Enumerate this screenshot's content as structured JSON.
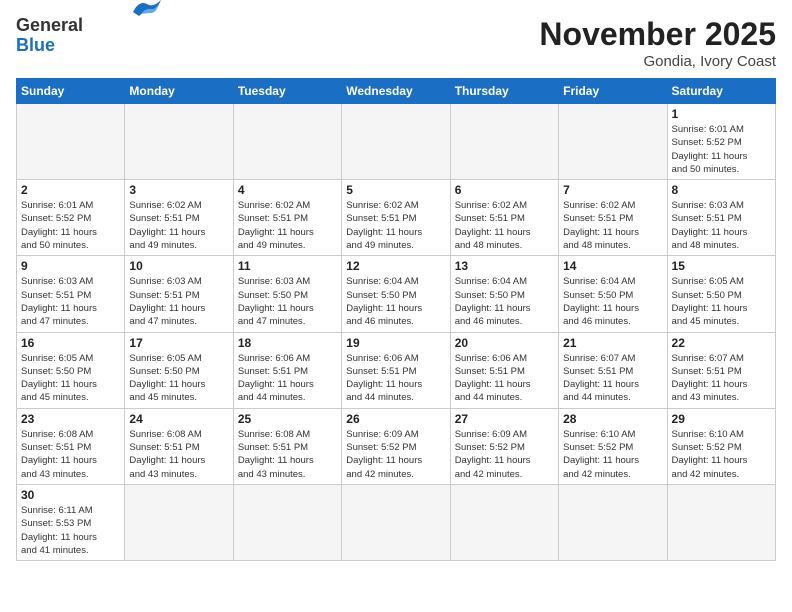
{
  "header": {
    "logo_general": "General",
    "logo_blue": "Blue",
    "month_title": "November 2025",
    "location": "Gondia, Ivory Coast"
  },
  "days_of_week": [
    "Sunday",
    "Monday",
    "Tuesday",
    "Wednesday",
    "Thursday",
    "Friday",
    "Saturday"
  ],
  "weeks": [
    [
      {
        "day": "",
        "info": ""
      },
      {
        "day": "",
        "info": ""
      },
      {
        "day": "",
        "info": ""
      },
      {
        "day": "",
        "info": ""
      },
      {
        "day": "",
        "info": ""
      },
      {
        "day": "",
        "info": ""
      },
      {
        "day": "1",
        "info": "Sunrise: 6:01 AM\nSunset: 5:52 PM\nDaylight: 11 hours\nand 50 minutes."
      }
    ],
    [
      {
        "day": "2",
        "info": "Sunrise: 6:01 AM\nSunset: 5:52 PM\nDaylight: 11 hours\nand 50 minutes."
      },
      {
        "day": "3",
        "info": "Sunrise: 6:02 AM\nSunset: 5:51 PM\nDaylight: 11 hours\nand 49 minutes."
      },
      {
        "day": "4",
        "info": "Sunrise: 6:02 AM\nSunset: 5:51 PM\nDaylight: 11 hours\nand 49 minutes."
      },
      {
        "day": "5",
        "info": "Sunrise: 6:02 AM\nSunset: 5:51 PM\nDaylight: 11 hours\nand 49 minutes."
      },
      {
        "day": "6",
        "info": "Sunrise: 6:02 AM\nSunset: 5:51 PM\nDaylight: 11 hours\nand 48 minutes."
      },
      {
        "day": "7",
        "info": "Sunrise: 6:02 AM\nSunset: 5:51 PM\nDaylight: 11 hours\nand 48 minutes."
      },
      {
        "day": "8",
        "info": "Sunrise: 6:03 AM\nSunset: 5:51 PM\nDaylight: 11 hours\nand 48 minutes."
      }
    ],
    [
      {
        "day": "9",
        "info": "Sunrise: 6:03 AM\nSunset: 5:51 PM\nDaylight: 11 hours\nand 47 minutes."
      },
      {
        "day": "10",
        "info": "Sunrise: 6:03 AM\nSunset: 5:51 PM\nDaylight: 11 hours\nand 47 minutes."
      },
      {
        "day": "11",
        "info": "Sunrise: 6:03 AM\nSunset: 5:50 PM\nDaylight: 11 hours\nand 47 minutes."
      },
      {
        "day": "12",
        "info": "Sunrise: 6:04 AM\nSunset: 5:50 PM\nDaylight: 11 hours\nand 46 minutes."
      },
      {
        "day": "13",
        "info": "Sunrise: 6:04 AM\nSunset: 5:50 PM\nDaylight: 11 hours\nand 46 minutes."
      },
      {
        "day": "14",
        "info": "Sunrise: 6:04 AM\nSunset: 5:50 PM\nDaylight: 11 hours\nand 46 minutes."
      },
      {
        "day": "15",
        "info": "Sunrise: 6:05 AM\nSunset: 5:50 PM\nDaylight: 11 hours\nand 45 minutes."
      }
    ],
    [
      {
        "day": "16",
        "info": "Sunrise: 6:05 AM\nSunset: 5:50 PM\nDaylight: 11 hours\nand 45 minutes."
      },
      {
        "day": "17",
        "info": "Sunrise: 6:05 AM\nSunset: 5:50 PM\nDaylight: 11 hours\nand 45 minutes."
      },
      {
        "day": "18",
        "info": "Sunrise: 6:06 AM\nSunset: 5:51 PM\nDaylight: 11 hours\nand 44 minutes."
      },
      {
        "day": "19",
        "info": "Sunrise: 6:06 AM\nSunset: 5:51 PM\nDaylight: 11 hours\nand 44 minutes."
      },
      {
        "day": "20",
        "info": "Sunrise: 6:06 AM\nSunset: 5:51 PM\nDaylight: 11 hours\nand 44 minutes."
      },
      {
        "day": "21",
        "info": "Sunrise: 6:07 AM\nSunset: 5:51 PM\nDaylight: 11 hours\nand 44 minutes."
      },
      {
        "day": "22",
        "info": "Sunrise: 6:07 AM\nSunset: 5:51 PM\nDaylight: 11 hours\nand 43 minutes."
      }
    ],
    [
      {
        "day": "23",
        "info": "Sunrise: 6:08 AM\nSunset: 5:51 PM\nDaylight: 11 hours\nand 43 minutes."
      },
      {
        "day": "24",
        "info": "Sunrise: 6:08 AM\nSunset: 5:51 PM\nDaylight: 11 hours\nand 43 minutes."
      },
      {
        "day": "25",
        "info": "Sunrise: 6:08 AM\nSunset: 5:51 PM\nDaylight: 11 hours\nand 43 minutes."
      },
      {
        "day": "26",
        "info": "Sunrise: 6:09 AM\nSunset: 5:52 PM\nDaylight: 11 hours\nand 42 minutes."
      },
      {
        "day": "27",
        "info": "Sunrise: 6:09 AM\nSunset: 5:52 PM\nDaylight: 11 hours\nand 42 minutes."
      },
      {
        "day": "28",
        "info": "Sunrise: 6:10 AM\nSunset: 5:52 PM\nDaylight: 11 hours\nand 42 minutes."
      },
      {
        "day": "29",
        "info": "Sunrise: 6:10 AM\nSunset: 5:52 PM\nDaylight: 11 hours\nand 42 minutes."
      }
    ],
    [
      {
        "day": "30",
        "info": "Sunrise: 6:11 AM\nSunset: 5:53 PM\nDaylight: 11 hours\nand 41 minutes."
      },
      {
        "day": "",
        "info": ""
      },
      {
        "day": "",
        "info": ""
      },
      {
        "day": "",
        "info": ""
      },
      {
        "day": "",
        "info": ""
      },
      {
        "day": "",
        "info": ""
      },
      {
        "day": "",
        "info": ""
      }
    ]
  ]
}
